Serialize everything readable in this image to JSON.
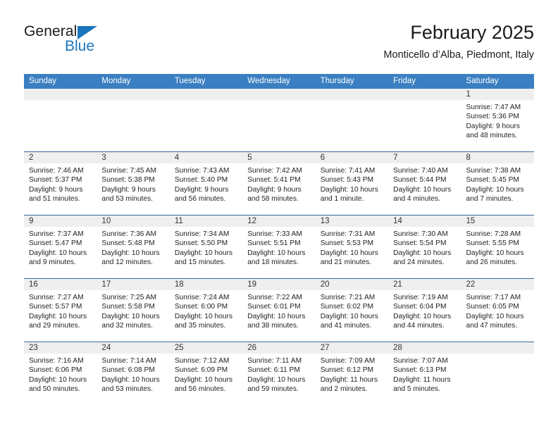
{
  "brand": {
    "name_part1": "General",
    "name_part2": "Blue",
    "triangle_color": "#1b75bb"
  },
  "header": {
    "title": "February 2025",
    "subtitle": "Monticello d’Alba, Piedmont, Italy"
  },
  "theme": {
    "header_bg": "#3a7fc1",
    "header_text": "#ffffff",
    "day_band_bg": "#efefef",
    "row_separator": "#35699e"
  },
  "weekdays": [
    "Sunday",
    "Monday",
    "Tuesday",
    "Wednesday",
    "Thursday",
    "Friday",
    "Saturday"
  ],
  "weeks": [
    [
      {
        "day": "",
        "lines": []
      },
      {
        "day": "",
        "lines": []
      },
      {
        "day": "",
        "lines": []
      },
      {
        "day": "",
        "lines": []
      },
      {
        "day": "",
        "lines": []
      },
      {
        "day": "",
        "lines": []
      },
      {
        "day": "1",
        "lines": [
          "Sunrise: 7:47 AM",
          "Sunset: 5:36 PM",
          "Daylight: 9 hours",
          "and 48 minutes."
        ]
      }
    ],
    [
      {
        "day": "2",
        "lines": [
          "Sunrise: 7:46 AM",
          "Sunset: 5:37 PM",
          "Daylight: 9 hours",
          "and 51 minutes."
        ]
      },
      {
        "day": "3",
        "lines": [
          "Sunrise: 7:45 AM",
          "Sunset: 5:38 PM",
          "Daylight: 9 hours",
          "and 53 minutes."
        ]
      },
      {
        "day": "4",
        "lines": [
          "Sunrise: 7:43 AM",
          "Sunset: 5:40 PM",
          "Daylight: 9 hours",
          "and 56 minutes."
        ]
      },
      {
        "day": "5",
        "lines": [
          "Sunrise: 7:42 AM",
          "Sunset: 5:41 PM",
          "Daylight: 9 hours",
          "and 58 minutes."
        ]
      },
      {
        "day": "6",
        "lines": [
          "Sunrise: 7:41 AM",
          "Sunset: 5:43 PM",
          "Daylight: 10 hours",
          "and 1 minute."
        ]
      },
      {
        "day": "7",
        "lines": [
          "Sunrise: 7:40 AM",
          "Sunset: 5:44 PM",
          "Daylight: 10 hours",
          "and 4 minutes."
        ]
      },
      {
        "day": "8",
        "lines": [
          "Sunrise: 7:38 AM",
          "Sunset: 5:45 PM",
          "Daylight: 10 hours",
          "and 7 minutes."
        ]
      }
    ],
    [
      {
        "day": "9",
        "lines": [
          "Sunrise: 7:37 AM",
          "Sunset: 5:47 PM",
          "Daylight: 10 hours",
          "and 9 minutes."
        ]
      },
      {
        "day": "10",
        "lines": [
          "Sunrise: 7:36 AM",
          "Sunset: 5:48 PM",
          "Daylight: 10 hours",
          "and 12 minutes."
        ]
      },
      {
        "day": "11",
        "lines": [
          "Sunrise: 7:34 AM",
          "Sunset: 5:50 PM",
          "Daylight: 10 hours",
          "and 15 minutes."
        ]
      },
      {
        "day": "12",
        "lines": [
          "Sunrise: 7:33 AM",
          "Sunset: 5:51 PM",
          "Daylight: 10 hours",
          "and 18 minutes."
        ]
      },
      {
        "day": "13",
        "lines": [
          "Sunrise: 7:31 AM",
          "Sunset: 5:53 PM",
          "Daylight: 10 hours",
          "and 21 minutes."
        ]
      },
      {
        "day": "14",
        "lines": [
          "Sunrise: 7:30 AM",
          "Sunset: 5:54 PM",
          "Daylight: 10 hours",
          "and 24 minutes."
        ]
      },
      {
        "day": "15",
        "lines": [
          "Sunrise: 7:28 AM",
          "Sunset: 5:55 PM",
          "Daylight: 10 hours",
          "and 26 minutes."
        ]
      }
    ],
    [
      {
        "day": "16",
        "lines": [
          "Sunrise: 7:27 AM",
          "Sunset: 5:57 PM",
          "Daylight: 10 hours",
          "and 29 minutes."
        ]
      },
      {
        "day": "17",
        "lines": [
          "Sunrise: 7:25 AM",
          "Sunset: 5:58 PM",
          "Daylight: 10 hours",
          "and 32 minutes."
        ]
      },
      {
        "day": "18",
        "lines": [
          "Sunrise: 7:24 AM",
          "Sunset: 6:00 PM",
          "Daylight: 10 hours",
          "and 35 minutes."
        ]
      },
      {
        "day": "19",
        "lines": [
          "Sunrise: 7:22 AM",
          "Sunset: 6:01 PM",
          "Daylight: 10 hours",
          "and 38 minutes."
        ]
      },
      {
        "day": "20",
        "lines": [
          "Sunrise: 7:21 AM",
          "Sunset: 6:02 PM",
          "Daylight: 10 hours",
          "and 41 minutes."
        ]
      },
      {
        "day": "21",
        "lines": [
          "Sunrise: 7:19 AM",
          "Sunset: 6:04 PM",
          "Daylight: 10 hours",
          "and 44 minutes."
        ]
      },
      {
        "day": "22",
        "lines": [
          "Sunrise: 7:17 AM",
          "Sunset: 6:05 PM",
          "Daylight: 10 hours",
          "and 47 minutes."
        ]
      }
    ],
    [
      {
        "day": "23",
        "lines": [
          "Sunrise: 7:16 AM",
          "Sunset: 6:06 PM",
          "Daylight: 10 hours",
          "and 50 minutes."
        ]
      },
      {
        "day": "24",
        "lines": [
          "Sunrise: 7:14 AM",
          "Sunset: 6:08 PM",
          "Daylight: 10 hours",
          "and 53 minutes."
        ]
      },
      {
        "day": "25",
        "lines": [
          "Sunrise: 7:12 AM",
          "Sunset: 6:09 PM",
          "Daylight: 10 hours",
          "and 56 minutes."
        ]
      },
      {
        "day": "26",
        "lines": [
          "Sunrise: 7:11 AM",
          "Sunset: 6:11 PM",
          "Daylight: 10 hours",
          "and 59 minutes."
        ]
      },
      {
        "day": "27",
        "lines": [
          "Sunrise: 7:09 AM",
          "Sunset: 6:12 PM",
          "Daylight: 11 hours",
          "and 2 minutes."
        ]
      },
      {
        "day": "28",
        "lines": [
          "Sunrise: 7:07 AM",
          "Sunset: 6:13 PM",
          "Daylight: 11 hours",
          "and 5 minutes."
        ]
      },
      {
        "day": "",
        "lines": []
      }
    ]
  ]
}
